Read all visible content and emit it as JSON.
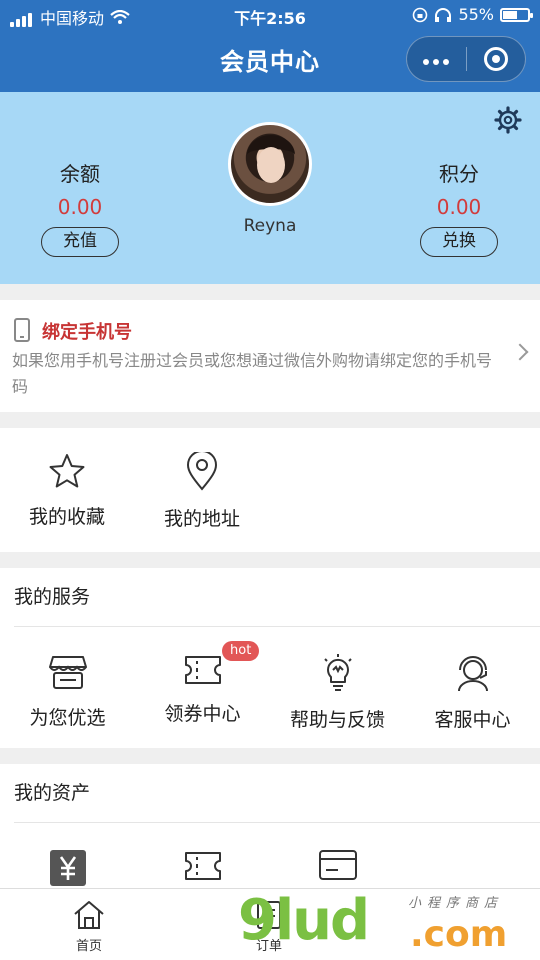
{
  "status": {
    "carrier": "中国移动",
    "time": "下午2:56",
    "battery": "55%"
  },
  "nav": {
    "title": "会员中心"
  },
  "profile": {
    "balance_label": "余额",
    "balance_value": "0.00",
    "recharge_label": "充值",
    "points_label": "积分",
    "points_value": "0.00",
    "exchange_label": "兑换",
    "username": "Reyna"
  },
  "bind": {
    "title": "绑定手机号",
    "desc": "如果您用手机号注册过会员或您想通过微信外购物请绑定您的手机号码"
  },
  "quick": [
    {
      "label": "我的收藏",
      "icon": "star-icon"
    },
    {
      "label": "我的地址",
      "icon": "location-pin-icon"
    }
  ],
  "services": {
    "title": "我的服务",
    "items": [
      {
        "label": "为您优选",
        "icon": "store-icon"
      },
      {
        "label": "领券中心",
        "icon": "ticket-icon",
        "badge": "hot"
      },
      {
        "label": "帮助与反馈",
        "icon": "lightbulb-icon"
      },
      {
        "label": "客服中心",
        "icon": "headset-icon"
      }
    ]
  },
  "assets": {
    "title": "我的资产",
    "items": [
      {
        "icon": "yuan-icon"
      },
      {
        "icon": "coupon-icon"
      },
      {
        "icon": "card-icon"
      }
    ]
  },
  "tabbar": [
    {
      "label": "首页",
      "icon": "home-icon"
    },
    {
      "label": "订单",
      "icon": "order-icon"
    }
  ],
  "watermark": {
    "brand": "9lud",
    "domain": ".com",
    "tagline": "小程序商店"
  }
}
